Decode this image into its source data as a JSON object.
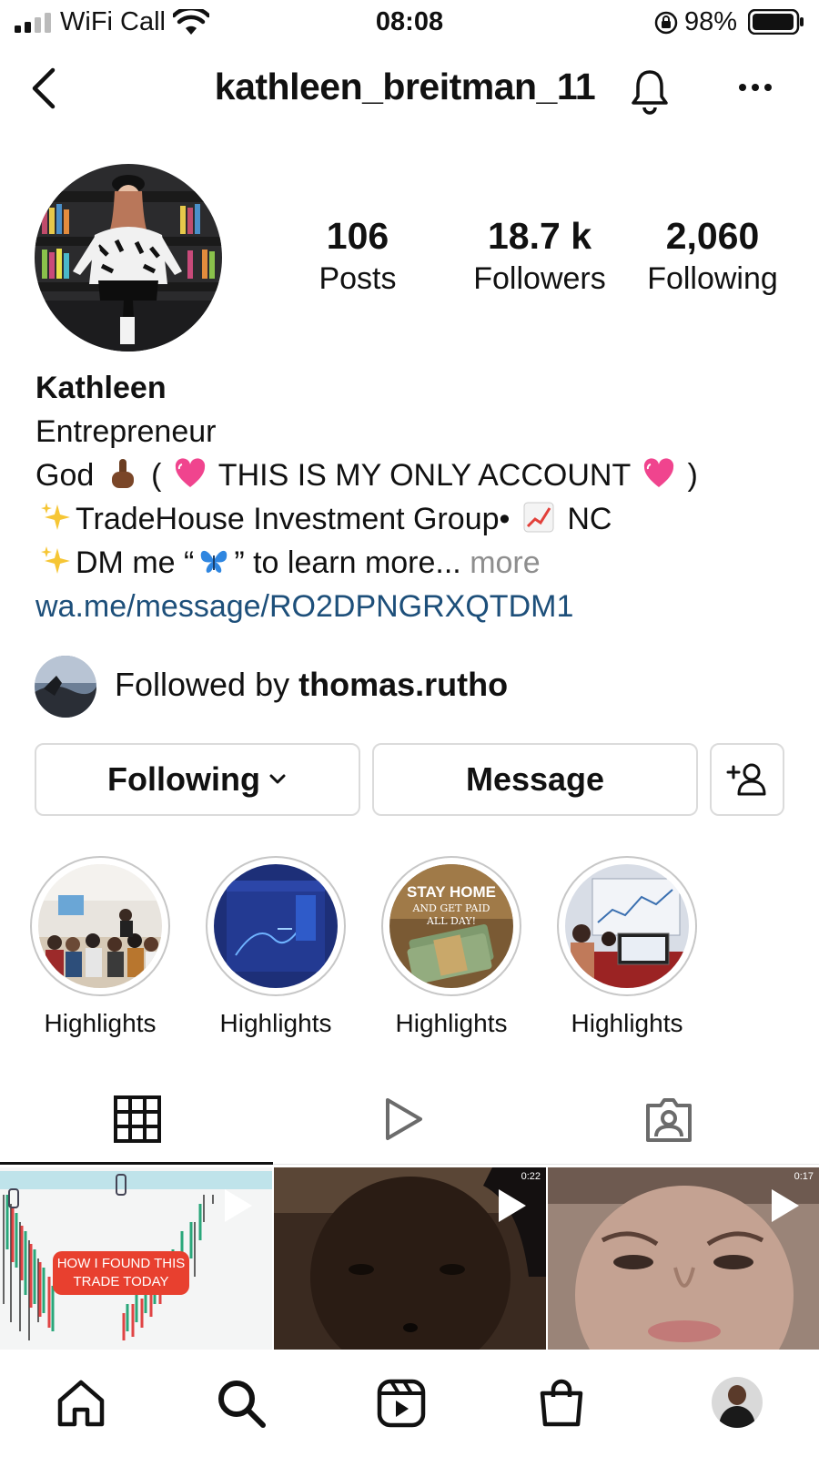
{
  "status_bar": {
    "carrier": "WiFi Call",
    "time": "08:08",
    "battery": "98%"
  },
  "header": {
    "username": "kathleen_breitman_11"
  },
  "profile": {
    "stats": [
      {
        "value": "106",
        "label": "Posts"
      },
      {
        "value": "18.7 k",
        "label": "Followers"
      },
      {
        "value": "2,060",
        "label": "Following"
      }
    ],
    "name": "Kathleen",
    "bio_line1": "Entrepreneur",
    "bio_line2_a": "God",
    "bio_line2_b": "(",
    "bio_line2_c": "THIS IS MY ONLY ACCOUNT",
    "bio_line2_d": ")",
    "bio_line3_a": "TradeHouse Investment Group•",
    "bio_line3_b": "NC",
    "bio_line4_a": "DM me “",
    "bio_line4_b": "” to learn more...",
    "more_label": "more",
    "link": "wa.me/message/RO2DPNGRXQTDM1"
  },
  "followed_by": {
    "prefix": "Followed by ",
    "user": "thomas.rutho"
  },
  "actions": {
    "following_label": "Following",
    "message_label": "Message"
  },
  "highlights": [
    {
      "label": "Highlights"
    },
    {
      "label": "Highlights"
    },
    {
      "label": "Highlights"
    },
    {
      "label": "Highlights"
    }
  ],
  "highlight_texts": {
    "h3_line1": "STAY HOME",
    "h3_line2": "AND GET PAID",
    "h3_line3": "ALL DAY!"
  },
  "posts": [
    {
      "caption": "How I found this trade today"
    },
    {
      "duration": "0:22"
    },
    {
      "duration": "0:17"
    }
  ],
  "icons": {
    "header": [
      "back-icon",
      "bell-icon",
      "more-icon"
    ],
    "tabs": [
      "grid-icon",
      "reels-icon",
      "tagged-icon"
    ],
    "nav": [
      "home-icon",
      "search-icon",
      "reels-icon",
      "shop-icon",
      "profile-avatar"
    ]
  },
  "colors": {
    "link": "#1d4f7a",
    "muted": "#8e8e8e",
    "border": "#dbdbdb",
    "caption_badge": "#e8402f"
  }
}
